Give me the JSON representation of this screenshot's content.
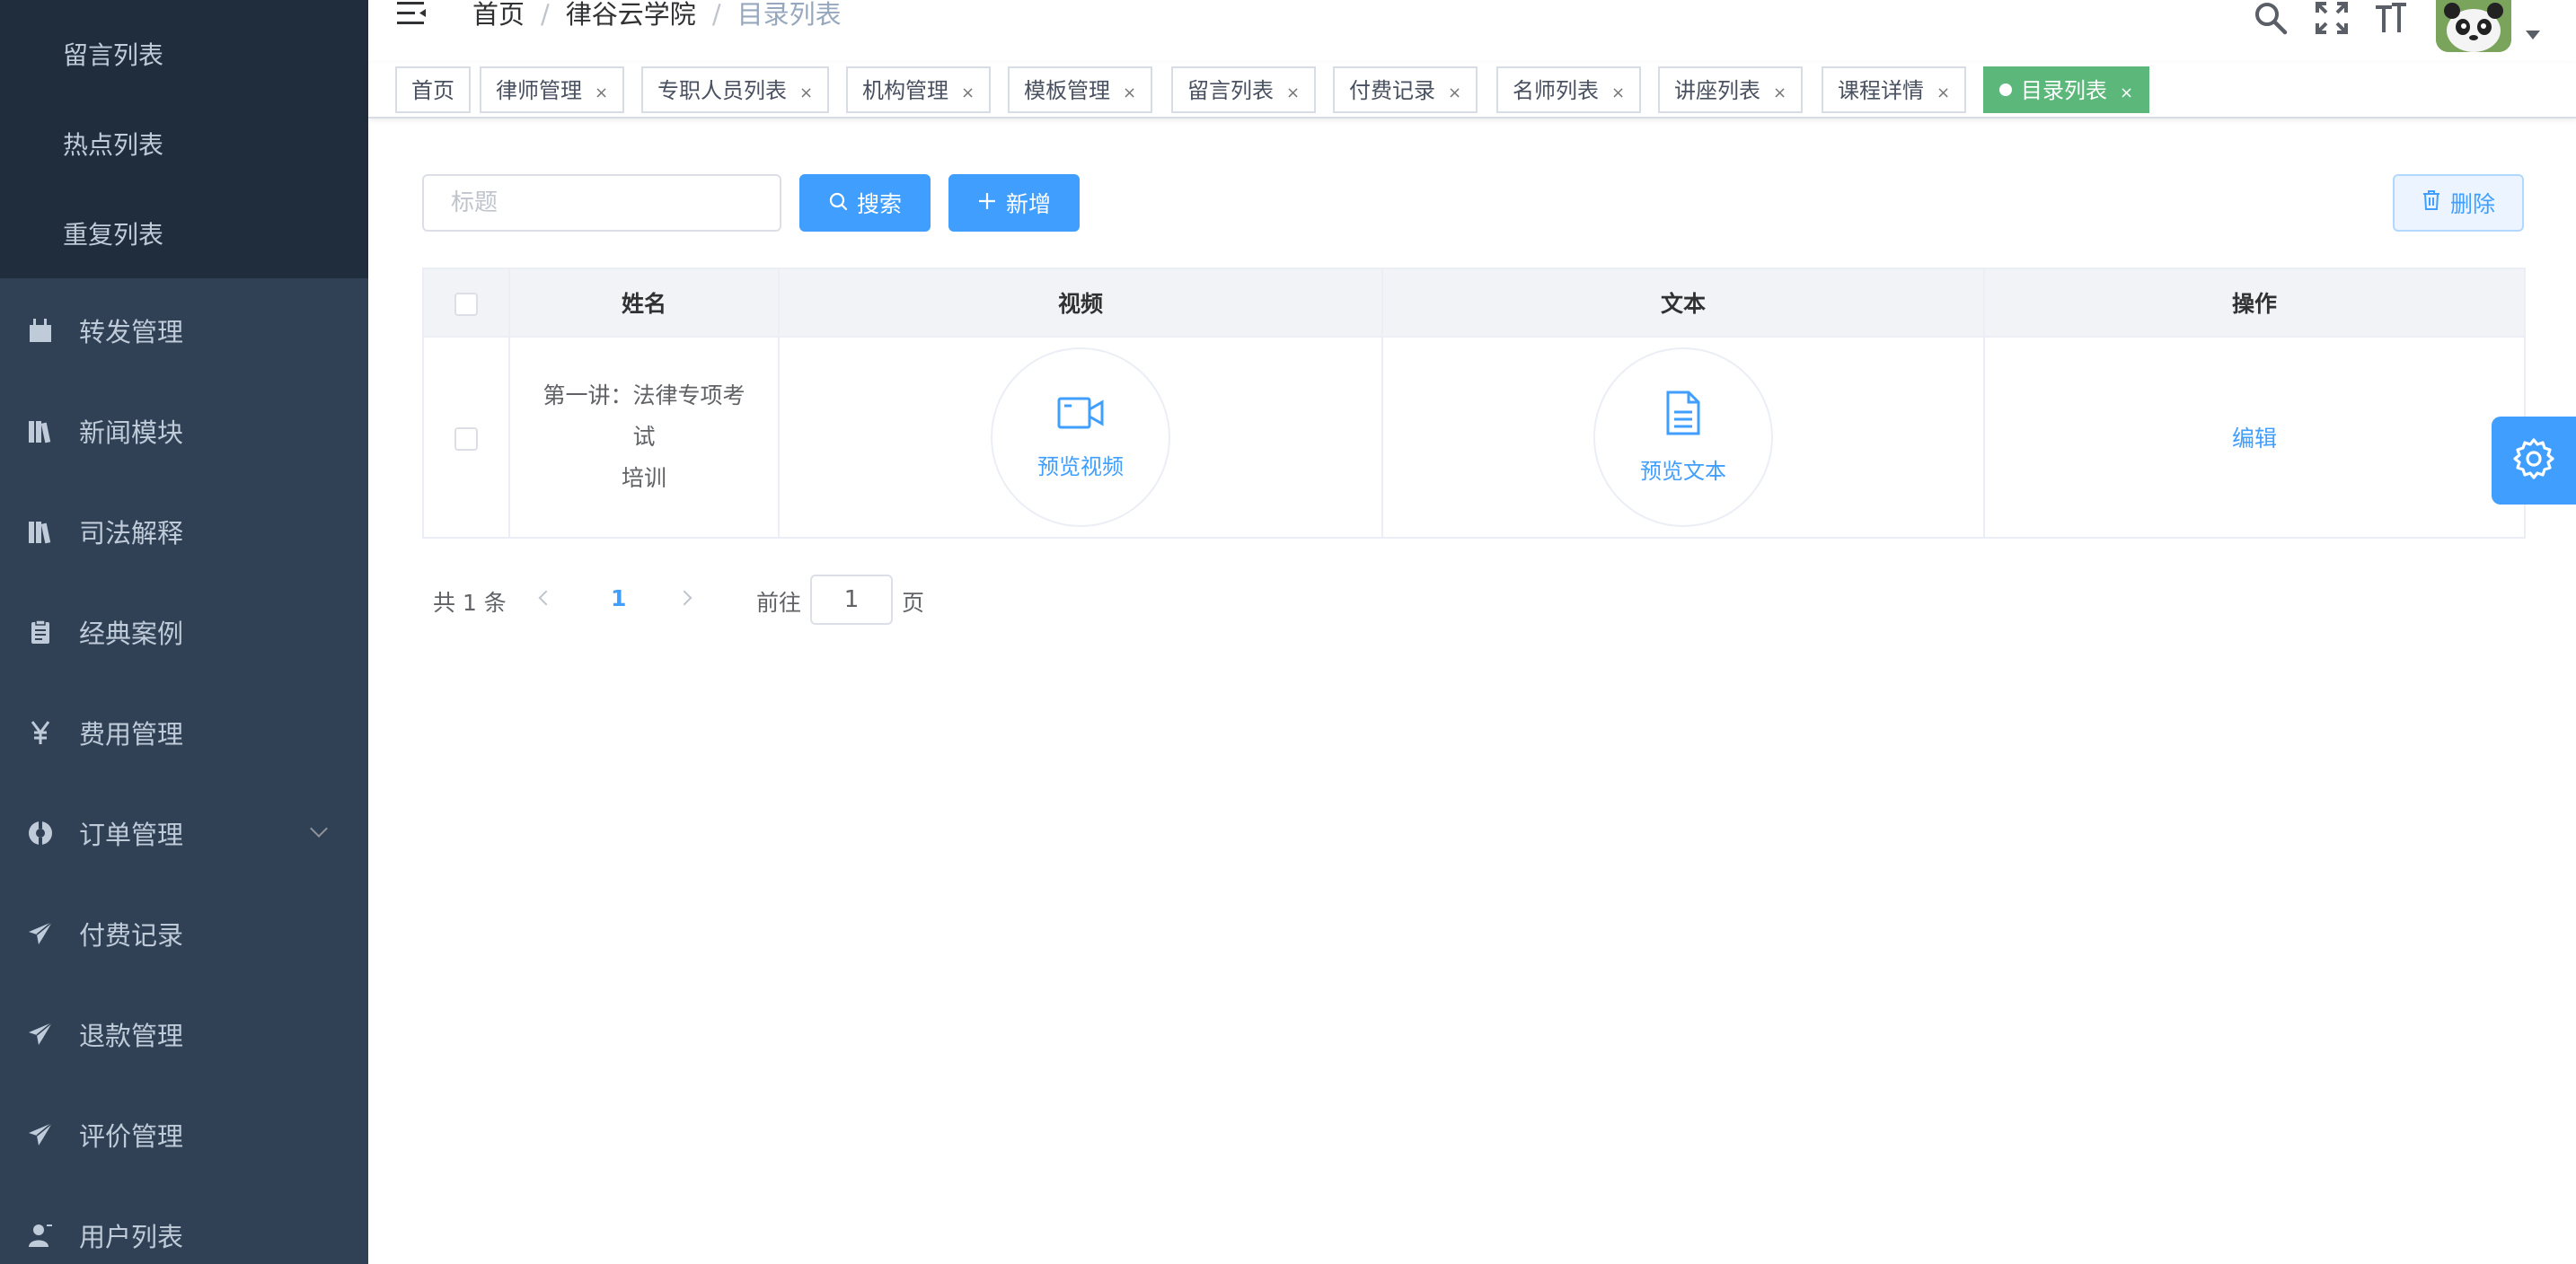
{
  "sidebar": {
    "submenu": [
      {
        "label": "留言列表"
      },
      {
        "label": "热点列表"
      },
      {
        "label": "重复列表"
      }
    ],
    "items": [
      {
        "label": "转发管理",
        "icon": "documentation-icon"
      },
      {
        "label": "新闻模块",
        "icon": "books-icon"
      },
      {
        "label": "司法解释",
        "icon": "books-icon"
      },
      {
        "label": "经典案例",
        "icon": "clipboard-icon"
      },
      {
        "label": "费用管理",
        "icon": "yen-icon"
      },
      {
        "label": "订单管理",
        "icon": "lifebuoy-icon",
        "expandable": true
      },
      {
        "label": "付费记录",
        "icon": "send-icon"
      },
      {
        "label": "退款管理",
        "icon": "send-icon"
      },
      {
        "label": "评价管理",
        "icon": "send-icon"
      },
      {
        "label": "用户列表",
        "icon": "user-icon"
      }
    ]
  },
  "navbar": {
    "breadcrumb": [
      "首页",
      "律谷云学院",
      "目录列表"
    ],
    "icons": [
      "search-icon",
      "fullscreen-icon",
      "text-size-icon"
    ],
    "avatar": "panda-avatar"
  },
  "tags": [
    {
      "label": "首页",
      "closable": false
    },
    {
      "label": "律师管理",
      "closable": true
    },
    {
      "label": "专职人员列表",
      "closable": true
    },
    {
      "label": "机构管理",
      "closable": true
    },
    {
      "label": "模板管理",
      "closable": true
    },
    {
      "label": "留言列表",
      "closable": true
    },
    {
      "label": "付费记录",
      "closable": true
    },
    {
      "label": "名师列表",
      "closable": true
    },
    {
      "label": "讲座列表",
      "closable": true
    },
    {
      "label": "课程详情",
      "closable": true
    },
    {
      "label": "目录列表",
      "closable": true,
      "active": true
    }
  ],
  "tag_close_glyph": "×",
  "filter": {
    "title_placeholder": "标题",
    "search_label": "搜索",
    "add_label": "新增",
    "delete_label": "删除"
  },
  "table": {
    "columns": [
      "姓名",
      "视频",
      "文本",
      "操作"
    ],
    "rows": [
      {
        "name_line1": "第一讲：法律专项考试",
        "name_line2": "培训",
        "video_label": "预览视频",
        "text_label": "预览文本",
        "action_label": "编辑"
      }
    ]
  },
  "pagination": {
    "total": "共 1 条",
    "current_page": "1",
    "goto": "前往",
    "goto_value": "1",
    "page_suffix": "页"
  },
  "colors": {
    "sidebar_bg": "#304156",
    "submenu_bg": "#1f2d3d",
    "primary": "#409eff",
    "active_tag": "#5cb87a"
  }
}
